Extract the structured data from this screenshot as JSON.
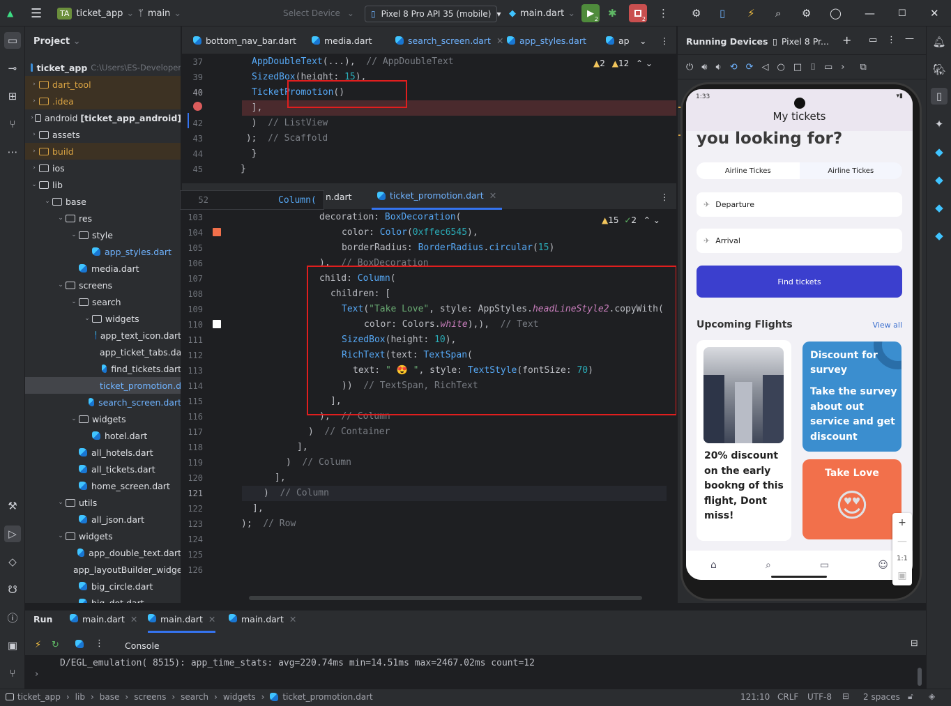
{
  "titlebar": {
    "project_badge": "TA",
    "project": "ticket_app",
    "branch": "main",
    "device_select": "Select Device",
    "device": "Pixel 8 Pro API 35 (mobile)",
    "run_config": "main.dart",
    "run_badge": "2",
    "stop_badge": "2"
  },
  "project_panel": {
    "title": "Project",
    "root": "ticket_app",
    "root_path": "C:\\Users\\ES-Developer",
    "items": [
      {
        "label": "dart_tool",
        "depth": 1,
        "type": "folder",
        "exp": false,
        "style": "excl"
      },
      {
        "label": ".idea",
        "depth": 1,
        "type": "folder",
        "exp": false,
        "style": "excl"
      },
      {
        "label": "android",
        "extra": "[ticket_app_android]",
        "depth": 1,
        "type": "folder",
        "exp": false
      },
      {
        "label": "assets",
        "depth": 1,
        "type": "folder",
        "exp": false
      },
      {
        "label": "build",
        "depth": 1,
        "type": "folder",
        "exp": false,
        "style": "excl"
      },
      {
        "label": "ios",
        "depth": 1,
        "type": "folder",
        "exp": false
      },
      {
        "label": "lib",
        "depth": 1,
        "type": "folder",
        "exp": true
      },
      {
        "label": "base",
        "depth": 2,
        "type": "folder",
        "exp": true
      },
      {
        "label": "res",
        "depth": 3,
        "type": "folder",
        "exp": true
      },
      {
        "label": "style",
        "depth": 4,
        "type": "folder",
        "exp": true
      },
      {
        "label": "app_styles.dart",
        "depth": 5,
        "type": "dart",
        "color": "blue"
      },
      {
        "label": "media.dart",
        "depth": 4,
        "type": "dart"
      },
      {
        "label": "screens",
        "depth": 3,
        "type": "folder",
        "exp": true
      },
      {
        "label": "search",
        "depth": 4,
        "type": "folder",
        "exp": true
      },
      {
        "label": "widgets",
        "depth": 5,
        "type": "folder",
        "exp": true
      },
      {
        "label": "app_text_icon.dart",
        "depth": 6,
        "type": "dart"
      },
      {
        "label": "app_ticket_tabs.dart",
        "depth": 6,
        "type": "dart"
      },
      {
        "label": "find_tickets.dart",
        "depth": 6,
        "type": "dart"
      },
      {
        "label": "ticket_promotion.dart",
        "depth": 6,
        "type": "dart",
        "color": "blue",
        "style": "sel"
      },
      {
        "label": "search_screen.dart",
        "depth": 5,
        "type": "dart",
        "color": "blue"
      },
      {
        "label": "widgets",
        "depth": 4,
        "type": "folder",
        "exp": true
      },
      {
        "label": "hotel.dart",
        "depth": 5,
        "type": "dart"
      },
      {
        "label": "all_hotels.dart",
        "depth": 4,
        "type": "dart"
      },
      {
        "label": "all_tickets.dart",
        "depth": 4,
        "type": "dart"
      },
      {
        "label": "home_screen.dart",
        "depth": 4,
        "type": "dart"
      },
      {
        "label": "utils",
        "depth": 3,
        "type": "folder",
        "exp": true
      },
      {
        "label": "all_json.dart",
        "depth": 4,
        "type": "dart"
      },
      {
        "label": "widgets",
        "depth": 3,
        "type": "folder",
        "exp": true
      },
      {
        "label": "app_double_text.dart",
        "depth": 4,
        "type": "dart"
      },
      {
        "label": "app_layoutBuilder_widget.dart",
        "depth": 4,
        "type": "dart"
      },
      {
        "label": "big_circle.dart",
        "depth": 4,
        "type": "dart"
      },
      {
        "label": "big_dot.dart",
        "depth": 4,
        "type": "dart"
      }
    ]
  },
  "editor_top": {
    "tabs": [
      "bottom_nav_bar.dart",
      "media.dart",
      "search_screen.dart",
      "app_styles.dart",
      "ap"
    ],
    "warnings": "2",
    "weak_warnings": "12"
  },
  "editor_bottom": {
    "tab_partial": "n.dart",
    "tab": "ticket_promotion.dart",
    "sticky_line": "52",
    "sticky_code": "Column(",
    "warnings": "15",
    "checks": "2"
  },
  "running": {
    "title": "Running Devices",
    "device_tab": "Pixel 8 Pr..."
  },
  "app": {
    "time": "1:33",
    "title": "My tickets",
    "heading": "you looking for?",
    "tab1": "Airline Tickes",
    "tab2": "Airline Tickes",
    "departure": "Departure",
    "arrival": "Arrival",
    "find": "Find tickets",
    "upcoming": "Upcoming Flights",
    "view_all": "View all",
    "promo_text": "20% discount on the early bookng of this flight, Dont miss!",
    "discount_title": "Discount for survey",
    "discount_body": "Take the survey about out service and get discount",
    "take_love": "Take Love",
    "emoji": "😍",
    "zoom": "1:1"
  },
  "bottom": {
    "run": "Run",
    "tabs": [
      "main.dart",
      "main.dart",
      "main.dart"
    ],
    "console": "Console",
    "log": "D/EGL_emulation( 8515): app_time_stats: avg=220.74ms min=14.51ms max=2467.02ms count=12"
  },
  "status": {
    "breadcrumb": [
      "ticket_app",
      "lib",
      "base",
      "screens",
      "search",
      "widgets",
      "ticket_promotion.dart"
    ],
    "pos": "121:10",
    "eol": "CRLF",
    "enc": "UTF-8",
    "indent": "2 spaces"
  },
  "colors": {
    "accent": "#3574f0",
    "app_button": "#3b3fce",
    "discount_card": "#3b8ecf",
    "love_card": "#f2704b",
    "promo_color": "#ffc6545"
  }
}
